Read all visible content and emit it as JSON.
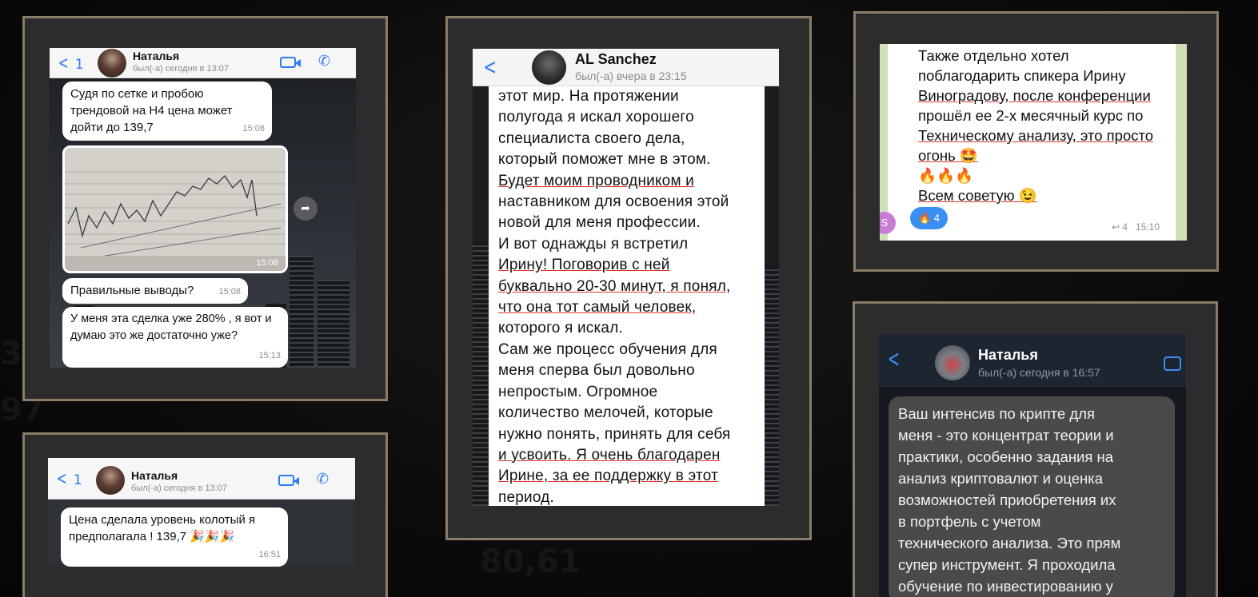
{
  "background": {
    "color": "#0b0b0b",
    "frame_color": "#8c7b67"
  },
  "card1": {
    "back_count": "1",
    "name": "Наталья",
    "status": "был(-а) сегодня в 13:07",
    "messages": [
      {
        "text": "Судя по сетке и пробою трендовой на H4 цена может дойти до 139,7",
        "time": "15:08"
      },
      {
        "image_time": "15:08"
      },
      {
        "text": "Правильные выводы?",
        "time": "15:08"
      },
      {
        "text": "У меня эта сделка уже 280% , я вот и думаю это же достаточно уже?",
        "time": "15:13"
      }
    ]
  },
  "card2": {
    "back_count": "1",
    "name": "Наталья",
    "status": "был(-а) сегодня в 13:07",
    "message": {
      "text": "Цена сделала уровень колотый я предполагала ! 139,7 🎉🎉🎉",
      "time": "16:51"
    }
  },
  "card3": {
    "name": "AL Sanchez",
    "status": "был(-а) вчера в 23:15",
    "lines": [
      "этот мир. На протяжении",
      "полугода я искал хорошего",
      "специалиста своего дела,",
      "который поможет мне в этом.",
      "Будет моим проводником и",
      "наставником для освоения этой",
      "новой для меня профессии.",
      "И вот однажды я встретил",
      "Ирину! Поговорив с ней",
      "буквально 20-30 минут, я понял,",
      "что она тот самый человек,",
      "которого я искал.",
      "Сам же процесс обучения для",
      "меня сперва был довольно",
      "непростым. Огромное",
      "количество мелочей, которые",
      "нужно понять, принять для себя",
      "и усвоить. Я очень благодарен",
      "Ирине, за ее поддержку в этот",
      "период."
    ]
  },
  "card4": {
    "lines": [
      "Также отдельно хотел",
      "поблагодарить спикера Ирину",
      "Виноградову, после конференции",
      "прошёл ее 2-х месячный курс по",
      "Техническому анализу, это просто",
      "огонь 🤩",
      "🔥🔥🔥",
      "Всем советую 😉"
    ],
    "reaction": "🔥 4",
    "replies": "4",
    "time": "15:10",
    "avatar_letter": "S"
  },
  "card5": {
    "name": "Наталья",
    "status": "был(-а) сегодня в 16:57",
    "lines": [
      "Ваш интенсив по крипте для",
      "меня - это концентрат теории и",
      "практики, особенно задания на",
      "анализ криптовалют и оценка",
      "возможностей приобретения их",
      "в портфель с учетом",
      "технического анализа. Это прям",
      "супер инструмент.  Я проходила",
      "обучение по инвестированию у"
    ]
  }
}
